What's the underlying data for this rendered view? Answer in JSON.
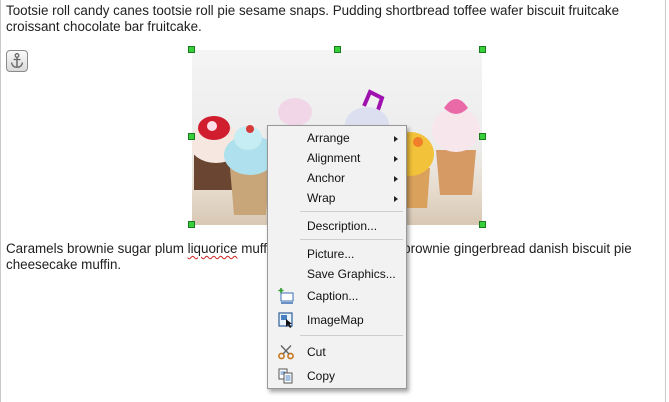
{
  "document": {
    "paragraph_1": "Tootsie roll candy canes tootsie roll pie sesame snaps. Pudding shortbread toffee wafer biscuit fruitcake croissant chocolate bar fruitcake.",
    "paragraph_2_start": "Caramels brownie sugar plum ",
    "paragraph_2_misspelled": "liquorice",
    "paragraph_2_end": " muffin jelly-o dessert. Icing brownie gingerbread danish biscuit pie cheesecake muffin."
  },
  "image": {
    "subject": "cupcakes photo"
  },
  "context_menu": {
    "arrange": "Arrange",
    "alignment": "Alignment",
    "anchor": "Anchor",
    "wrap": "Wrap",
    "description": "Description...",
    "picture": "Picture...",
    "save_graphics": "Save Graphics...",
    "caption": "Caption...",
    "imagemap": "ImageMap",
    "cut": "Cut",
    "copy": "Copy"
  },
  "colors": {
    "handle": "#37d03c",
    "menu_bg": "#f2f2f2"
  }
}
